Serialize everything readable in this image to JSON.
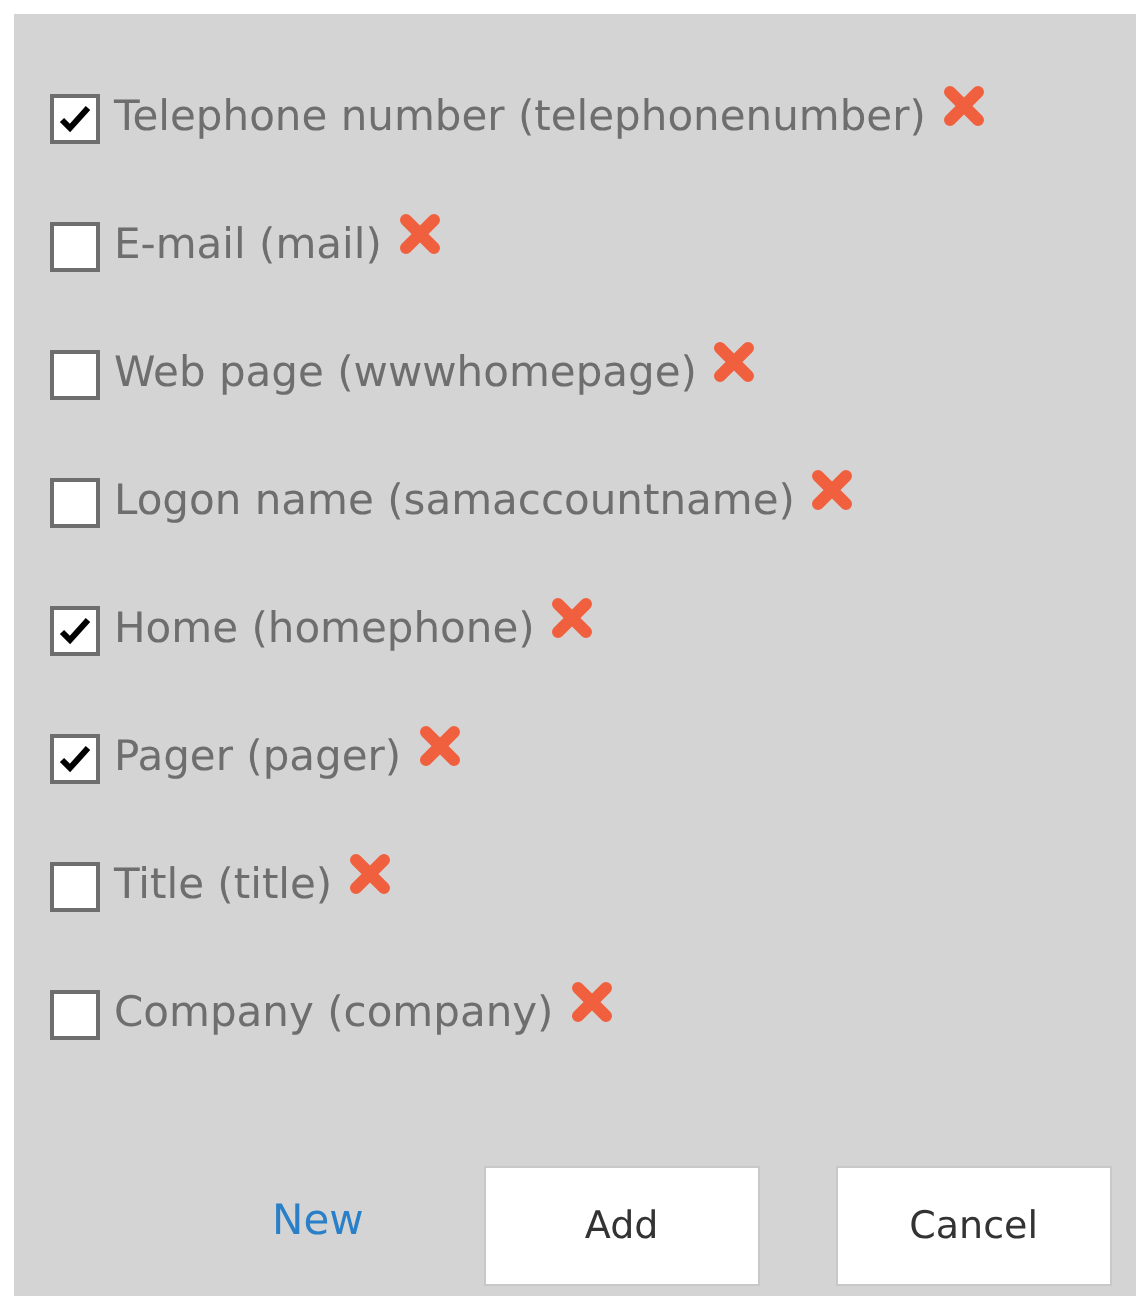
{
  "attributes": [
    {
      "label": "Telephone number (telephonenumber)",
      "checked": true
    },
    {
      "label": "E-mail (mail)",
      "checked": false
    },
    {
      "label": "Web page (wwwhomepage)",
      "checked": false
    },
    {
      "label": "Logon name (samaccountname)",
      "checked": false
    },
    {
      "label": "Home (homephone)",
      "checked": true
    },
    {
      "label": "Pager (pager)",
      "checked": true
    },
    {
      "label": "Title (title)",
      "checked": false
    },
    {
      "label": "Company (company)",
      "checked": false
    }
  ],
  "new_link": "New",
  "buttons": [
    "Add",
    "Cancel"
  ]
}
